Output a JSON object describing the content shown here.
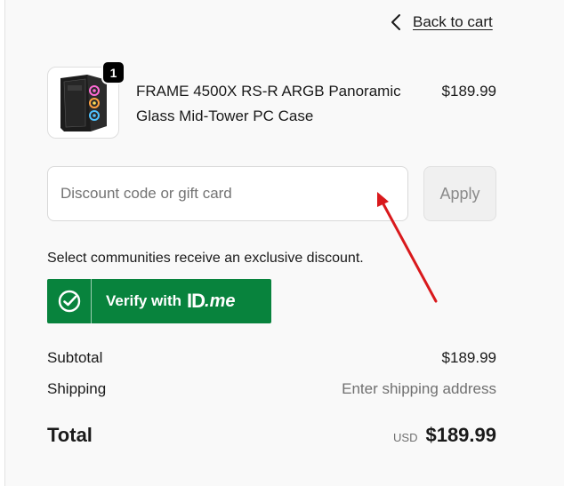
{
  "nav": {
    "back_label": "Back to cart"
  },
  "cart_item": {
    "quantity": "1",
    "name": "FRAME 4500X RS-R ARGB Panoramic Glass Mid-Tower PC Case",
    "price": "$189.99"
  },
  "discount": {
    "placeholder": "Discount code or gift card",
    "apply_label": "Apply"
  },
  "idme": {
    "info_text": "Select communities receive an exclusive discount.",
    "verify_label": "Verify with",
    "logo_id": "ID",
    "logo_me": ".me",
    "color": "#08833d"
  },
  "summary": {
    "subtotal_label": "Subtotal",
    "subtotal_value": "$189.99",
    "shipping_label": "Shipping",
    "shipping_value": "Enter shipping address",
    "total_label": "Total",
    "currency": "USD",
    "total_value": "$189.99"
  },
  "annotation": {
    "arrow_color": "#d9191c"
  }
}
